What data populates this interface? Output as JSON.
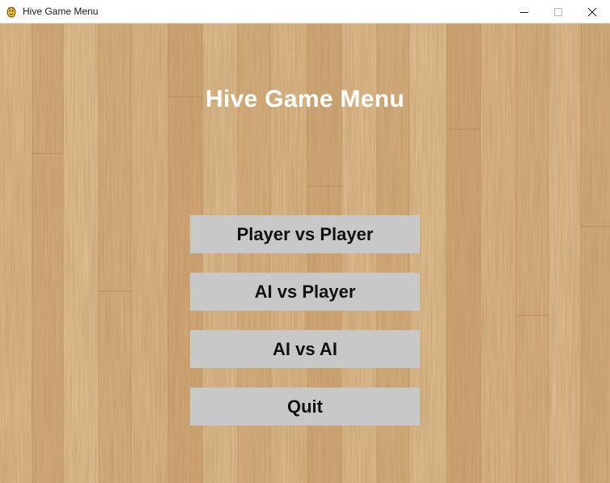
{
  "window": {
    "title": "Hive Game Menu",
    "app_icon": "pygame-snake-icon",
    "controls": [
      "minimize-icon",
      "maximize-icon",
      "close-icon"
    ]
  },
  "menu": {
    "heading": "Hive Game Menu",
    "buttons": [
      {
        "label": "Player vs Player"
      },
      {
        "label": "AI vs Player"
      },
      {
        "label": "AI vs AI"
      },
      {
        "label": "Quit"
      }
    ]
  },
  "colors": {
    "wood_base": "#dcb586",
    "button_bg": "#c8c8c8",
    "button_text": "#111111",
    "heading_text": "#ffffff"
  }
}
